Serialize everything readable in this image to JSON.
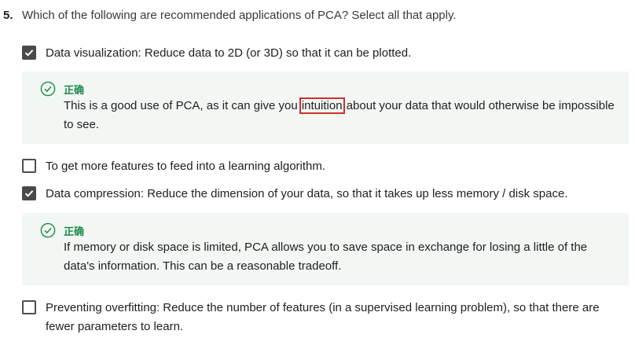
{
  "question": {
    "number": "5.",
    "text": "Which of the following are recommended applications of PCA? Select all that apply."
  },
  "options": [
    {
      "label": "Data visualization: Reduce data to 2D (or 3D) so that it can be plotted.",
      "checked": true,
      "feedback": {
        "title": "正确",
        "text_before": "This is a good use of PCA, as it can give you",
        "highlight": "intuition",
        "text_after": "about your data that would otherwise be impossible to see."
      }
    },
    {
      "label": "To get more features to feed into a learning algorithm.",
      "checked": false
    },
    {
      "label": "Data compression: Reduce the dimension of your data, so that it takes up less memory / disk space.",
      "checked": true,
      "feedback": {
        "title": "正确",
        "text": "If memory or disk space is limited, PCA allows you to save space in exchange for losing a little of the data's information. This can be a reasonable tradeoff."
      }
    },
    {
      "label": "Preventing overfitting: Reduce the number of features (in a supervised learning problem), so that there are fewer parameters to learn.",
      "checked": false
    }
  ],
  "icons": {
    "check": "check-icon",
    "correct": "check-circle-icon"
  },
  "colors": {
    "correct_green": "#1e8a4c",
    "feedback_bg": "#f2f7f4",
    "checkbox_fill": "#4a4a4a",
    "highlight_box": "#d32f2f"
  }
}
